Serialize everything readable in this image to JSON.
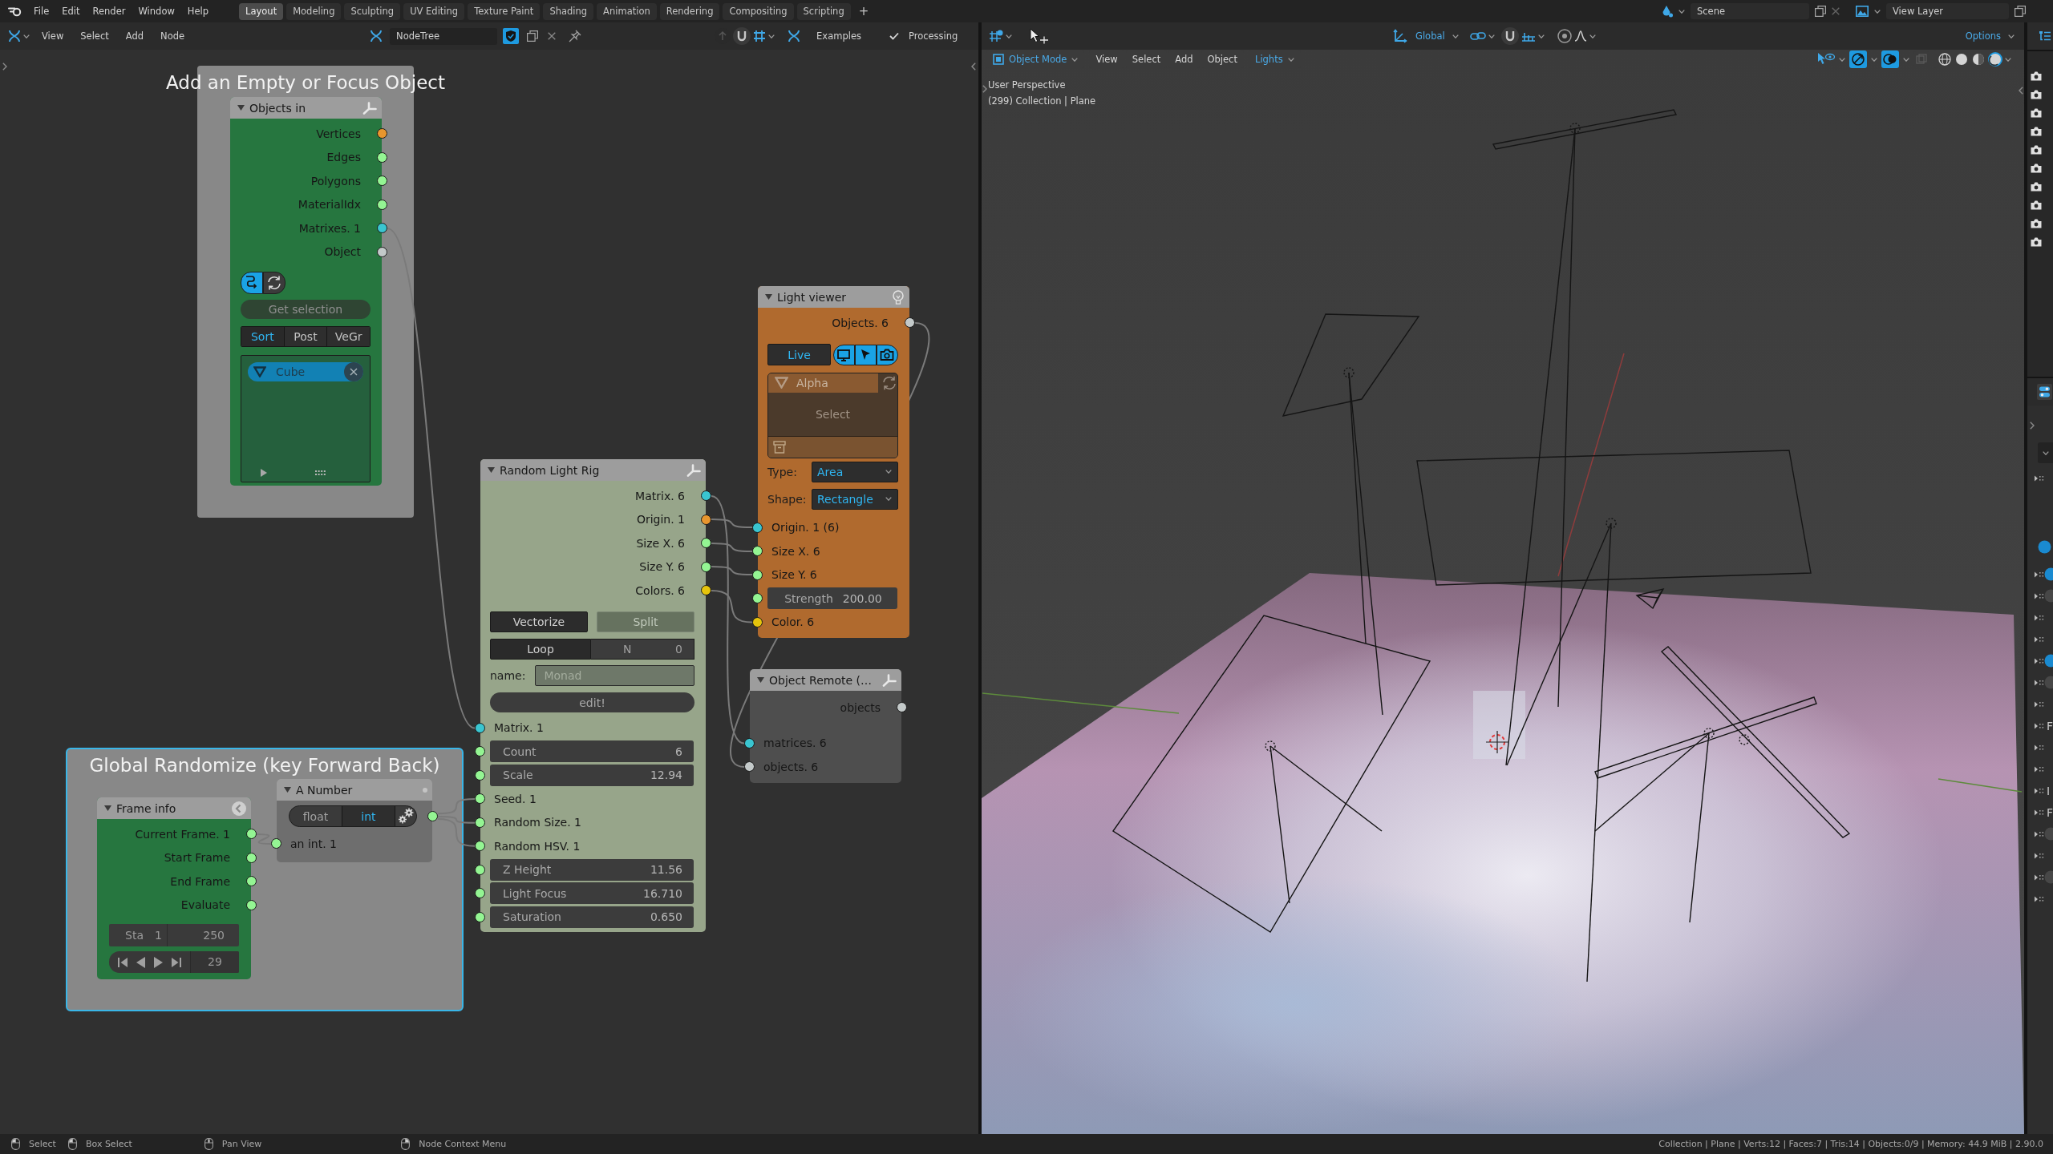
{
  "top_bar": {
    "menus": [
      "File",
      "Edit",
      "Render",
      "Window",
      "Help"
    ],
    "workspace_tabs": [
      {
        "label": "Layout",
        "selected": true
      },
      {
        "label": "Modeling",
        "selected": false
      },
      {
        "label": "Sculpting",
        "selected": false
      },
      {
        "label": "UV Editing",
        "selected": false
      },
      {
        "label": "Texture Paint",
        "selected": false
      },
      {
        "label": "Shading",
        "selected": false
      },
      {
        "label": "Animation",
        "selected": false
      },
      {
        "label": "Rendering",
        "selected": false
      },
      {
        "label": "Compositing",
        "selected": false
      },
      {
        "label": "Scripting",
        "selected": false
      }
    ],
    "add_tab": "+",
    "scene": "Scene",
    "view_layer": "View Layer"
  },
  "node_editor": {
    "header": {
      "menus": [
        "View",
        "Select",
        "Add",
        "Node"
      ],
      "node_tree": "NodeTree",
      "fake_user": true,
      "examples": "Examples",
      "processing": {
        "label": "Processing",
        "checked": true
      }
    },
    "frames": [
      {
        "label": "Add an Empty or Focus Object",
        "selected": false
      },
      {
        "label": "Global Randomize (key Forward Back)",
        "selected": true
      }
    ],
    "nodes": [
      {
        "title": "Objects in",
        "color": "#26763f",
        "rows": [
          {
            "kind": "output",
            "label": "Vertices",
            "color": "#e8962e"
          },
          {
            "kind": "output",
            "label": "Edges",
            "color": "#94f593"
          },
          {
            "kind": "output",
            "label": "Polygons",
            "color": "#94f593"
          },
          {
            "kind": "output",
            "label": "MaterialIdx",
            "color": "#94f593"
          },
          {
            "kind": "output",
            "label": "Matrixes. 1",
            "color": "#3ac5d0"
          },
          {
            "kind": "output",
            "label": "Object",
            "color": "#c3c9c9"
          },
          {
            "kind": "icon_toggles",
            "toggles": [
              {
                "on": true
              },
              {
                "on": false
              }
            ]
          },
          {
            "kind": "button",
            "label": "Get selection"
          },
          {
            "kind": "segmented",
            "options": [
              {
                "label": "Sort",
                "selected": true
              },
              {
                "label": "Post",
                "selected": false
              },
              {
                "label": "VeGr",
                "selected": false
              }
            ]
          },
          {
            "kind": "object_list",
            "items": [
              "Cube"
            ]
          }
        ]
      },
      {
        "title": "Random Light Rig",
        "color": "#97a58a",
        "rows": [
          {
            "kind": "output",
            "label": "Matrix. 6",
            "color": "#3ac5d0"
          },
          {
            "kind": "output",
            "label": "Origin. 1",
            "color": "#e8962e"
          },
          {
            "kind": "output",
            "label": "Size X. 6",
            "color": "#94f593"
          },
          {
            "kind": "output",
            "label": "Size Y. 6",
            "color": "#94f593"
          },
          {
            "kind": "output",
            "label": "Colors. 6",
            "color": "#e6c40c"
          },
          {
            "kind": "button_pair",
            "buttons": [
              {
                "label": "Vectorize",
                "disabled": false
              },
              {
                "label": "Split",
                "disabled": true
              }
            ]
          },
          {
            "kind": "loop",
            "label": "Loop",
            "field_label": "N",
            "value": "0"
          },
          {
            "kind": "text_field",
            "label": "name:",
            "placeholder": "Monad"
          },
          {
            "kind": "pill_button",
            "label": "edit!"
          },
          {
            "kind": "input",
            "label": "Matrix. 1",
            "color": "#3ac5d0"
          },
          {
            "kind": "input_field",
            "label": "Count",
            "value": "6",
            "color": "#94f593"
          },
          {
            "kind": "input_field",
            "label": "Scale",
            "value": "12.94",
            "color": "#94f593"
          },
          {
            "kind": "input",
            "label": "Seed. 1",
            "color": "#94f593"
          },
          {
            "kind": "input",
            "label": "Random Size. 1",
            "color": "#94f593"
          },
          {
            "kind": "input",
            "label": "Random HSV. 1",
            "color": "#94f593"
          },
          {
            "kind": "input_field",
            "label": "Z Height",
            "value": "11.56",
            "color": "#94f593"
          },
          {
            "kind": "input_field",
            "label": "Light Focus",
            "value": "16.710",
            "color": "#94f593"
          },
          {
            "kind": "input_field",
            "label": "Saturation",
            "value": "0.650",
            "color": "#94f593"
          }
        ]
      },
      {
        "title": "Light viewer",
        "color": "#b06a2e",
        "rows": [
          {
            "kind": "output",
            "label": "Objects. 6",
            "color": "#c3c9c9"
          },
          {
            "kind": "live_toggles",
            "label": "Live",
            "on": true,
            "toggles": [
              {
                "on": true
              },
              {
                "on": true
              },
              {
                "on": true
              }
            ]
          },
          {
            "kind": "collection_list",
            "item": "Alpha",
            "button": "Select"
          },
          {
            "kind": "dropdown",
            "label": "Type:",
            "value": "Area"
          },
          {
            "kind": "dropdown",
            "label": "Shape:",
            "value": "Rectangle"
          },
          {
            "kind": "input",
            "label": "Origin. 1 (6)",
            "color": "#3ac5d0"
          },
          {
            "kind": "input",
            "label": "Size X. 6",
            "color": "#94f593"
          },
          {
            "kind": "input",
            "label": "Size Y. 6",
            "color": "#94f593"
          },
          {
            "kind": "input_number",
            "label": "Strength",
            "value": "200.00",
            "color": "#94f593"
          },
          {
            "kind": "input",
            "label": "Color. 6",
            "color": "#e6c40c"
          }
        ]
      },
      {
        "title": "Object Remote (…",
        "color": "#4e4e4e",
        "rows": [
          {
            "kind": "output",
            "label": "objects",
            "color": "#c3c9c9"
          },
          {
            "kind": "input",
            "label": "matrices. 6",
            "color": "#3ac5d0"
          },
          {
            "kind": "input",
            "label": "objects. 6",
            "color": "#c3c9c9"
          }
        ]
      },
      {
        "title": "A Number",
        "color": "#6e6e6e",
        "rows": [
          {
            "kind": "segmented_out",
            "options": [
              {
                "label": "float",
                "selected": false
              },
              {
                "label": "int",
                "selected": true
              }
            ],
            "color": "#94f593"
          },
          {
            "kind": "input",
            "label": "an int. 1",
            "color": "#94f593"
          }
        ]
      },
      {
        "title": "Frame info",
        "color": "#26763f",
        "rows": [
          {
            "kind": "output",
            "label": "Current Frame. 1",
            "color": "#94f593"
          },
          {
            "kind": "output",
            "label": "Start Frame",
            "color": "#94f593"
          },
          {
            "kind": "output",
            "label": "End Frame",
            "color": "#94f593"
          },
          {
            "kind": "output",
            "label": "Evaluate",
            "color": "#94f593"
          },
          {
            "kind": "frame_range",
            "label": "Sta",
            "start": "1",
            "end": "250"
          },
          {
            "kind": "playback",
            "frame": "29"
          }
        ]
      }
    ]
  },
  "viewport": {
    "header": {
      "orientation": "Global",
      "options": "Options"
    },
    "mode": "Object Mode",
    "menus": [
      "View",
      "Select",
      "Add",
      "Object"
    ],
    "lights_menu": "Lights",
    "toggles": {
      "gizmos": true,
      "overlays": true,
      "xray": false
    },
    "shading_modes": [
      {
        "selected": false
      },
      {
        "selected": false
      },
      {
        "selected": false
      },
      {
        "selected": true
      }
    ],
    "info": [
      "User Perspective",
      "(299) Collection | Plane"
    ]
  },
  "properties_panel": {
    "rows": [
      {
        "kind": "panel"
      },
      {
        "kind": "toggle",
        "on": true
      },
      {
        "kind": "panel",
        "on": true
      },
      {
        "kind": "panel",
        "on": false
      },
      {
        "kind": "panel"
      },
      {
        "kind": "panel"
      },
      {
        "kind": "panel",
        "on": true
      },
      {
        "kind": "panel",
        "on": false
      },
      {
        "kind": "panel"
      },
      {
        "kind": "panel",
        "label": "F"
      },
      {
        "kind": "panel"
      },
      {
        "kind": "panel"
      },
      {
        "kind": "panel",
        "label": "I"
      },
      {
        "kind": "panel",
        "label": "F"
      },
      {
        "kind": "panel",
        "on": false
      },
      {
        "kind": "panel"
      },
      {
        "kind": "panel",
        "on": false
      },
      {
        "kind": "panel"
      }
    ]
  },
  "status_bar": {
    "hints": [
      "Select",
      "Box Select",
      "Pan View",
      "Node Context Menu"
    ],
    "stats": "Collection | Plane | Verts:12 | Faces:7 | Tris:14 | Objects:0/9 | Memory: 44.9 MiB | 2.90.0"
  }
}
